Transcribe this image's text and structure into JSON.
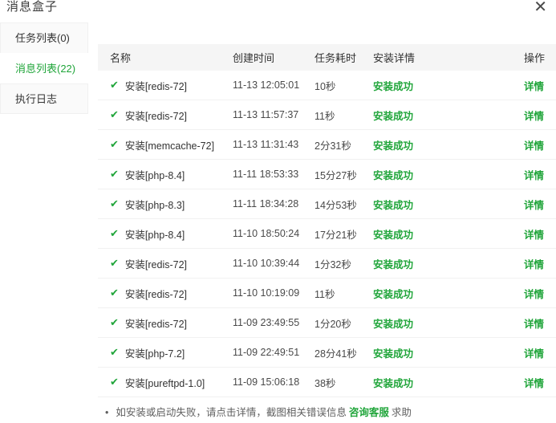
{
  "window": {
    "title": "消息盒子",
    "close_icon": "✕"
  },
  "colors": {
    "accent_green": "#20a53a",
    "header_bg": "#f5f5f5",
    "tab_bg": "#fafafa"
  },
  "sidebar": {
    "items": [
      {
        "label": "任务列表(0)",
        "active": false
      },
      {
        "label": "消息列表(22)",
        "active": true
      },
      {
        "label": "执行日志",
        "active": false
      }
    ]
  },
  "table": {
    "columns": [
      "名称",
      "创建时间",
      "任务耗时",
      "安装详情",
      "操作"
    ],
    "check_icon": "✔",
    "rows": [
      {
        "name": "安装[redis-72]",
        "created": "11-13 12:05:01",
        "duration": "10秒",
        "status": "安装成功",
        "action": "详情"
      },
      {
        "name": "安装[redis-72]",
        "created": "11-13 11:57:37",
        "duration": "11秒",
        "status": "安装成功",
        "action": "详情"
      },
      {
        "name": "安装[memcache-72]",
        "created": "11-13 11:31:43",
        "duration": "2分31秒",
        "status": "安装成功",
        "action": "详情"
      },
      {
        "name": "安装[php-8.4]",
        "created": "11-11 18:53:33",
        "duration": "15分27秒",
        "status": "安装成功",
        "action": "详情"
      },
      {
        "name": "安装[php-8.3]",
        "created": "11-11 18:34:28",
        "duration": "14分53秒",
        "status": "安装成功",
        "action": "详情"
      },
      {
        "name": "安装[php-8.4]",
        "created": "11-10 18:50:24",
        "duration": "17分21秒",
        "status": "安装成功",
        "action": "详情"
      },
      {
        "name": "安装[redis-72]",
        "created": "11-10 10:39:44",
        "duration": "1分32秒",
        "status": "安装成功",
        "action": "详情"
      },
      {
        "name": "安装[redis-72]",
        "created": "11-10 10:19:09",
        "duration": "11秒",
        "status": "安装成功",
        "action": "详情"
      },
      {
        "name": "安装[redis-72]",
        "created": "11-09 23:49:55",
        "duration": "1分20秒",
        "status": "安装成功",
        "action": "详情"
      },
      {
        "name": "安装[php-7.2]",
        "created": "11-09 22:49:51",
        "duration": "28分41秒",
        "status": "安装成功",
        "action": "详情"
      },
      {
        "name": "安装[pureftpd-1.0]",
        "created": "11-09 15:06:18",
        "duration": "38秒",
        "status": "安装成功",
        "action": "详情"
      }
    ]
  },
  "footnote": {
    "bullet": "•",
    "text_before": "如安装或启动失败，请点击详情，截图相关错误信息",
    "link": "咨询客服",
    "text_after": "求助"
  }
}
